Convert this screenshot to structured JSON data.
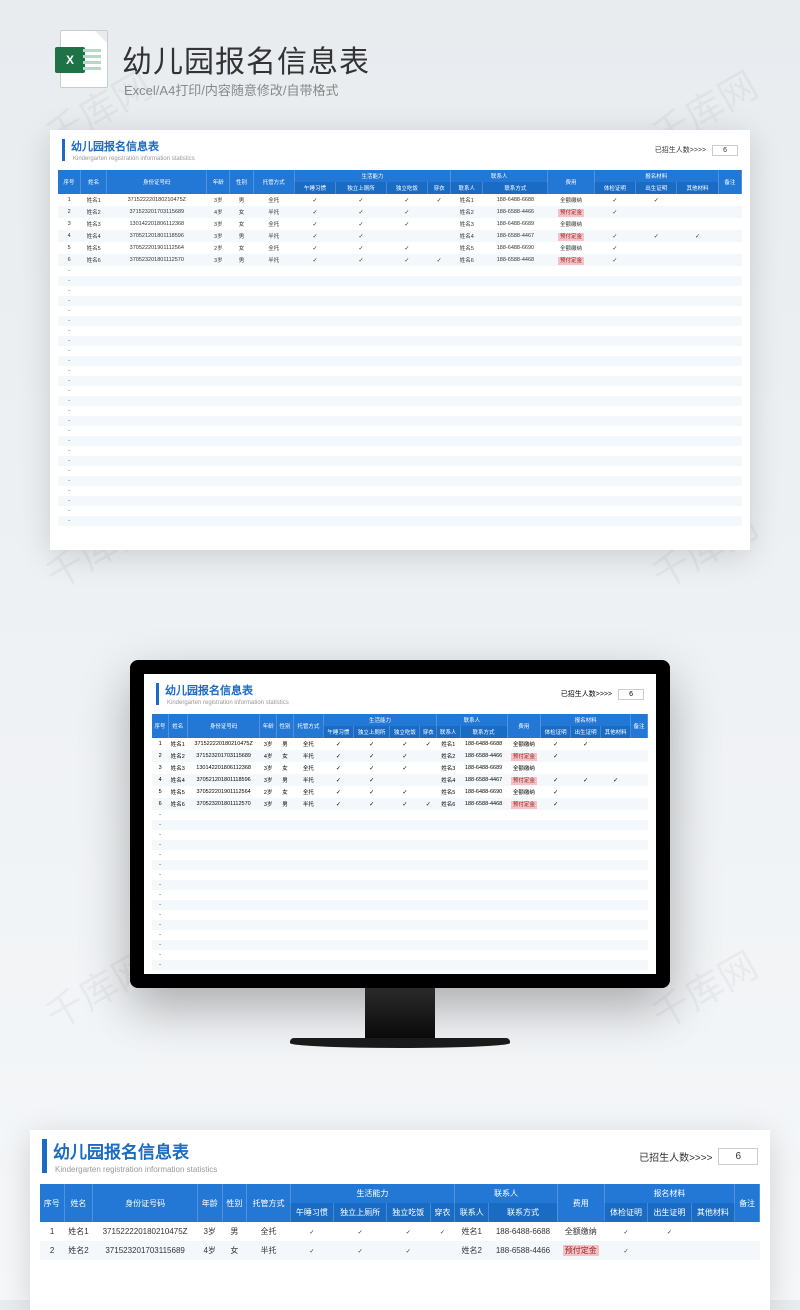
{
  "banner": {
    "title": "幼儿园报名信息表",
    "subtitle": "Excel/A4打印/内容随意修改/自带格式",
    "icon_label": "X"
  },
  "sheet": {
    "title": "幼儿园报名信息表",
    "subtitle": "Kindergarten registration information statistics",
    "enrolled_label": "已招生人数>>>>",
    "enrolled_count": "6"
  },
  "columns": {
    "seq": "序号",
    "name": "姓名",
    "id": "身份证号码",
    "age": "年龄",
    "gender": "性别",
    "care": "托管方式",
    "life_group": "生活能力",
    "nap": "午睡习惯",
    "toilet": "独立上厕所",
    "eat": "独立吃饭",
    "dress": "穿衣",
    "contact_group": "联系人",
    "contact": "联系人",
    "phone": "联系方式",
    "fee": "费用",
    "materials_group": "报名材料",
    "health": "体检证明",
    "birth": "出生证明",
    "other": "其他材料",
    "remark": "备注"
  },
  "fees": {
    "full": "全额缴纳",
    "deposit": "预付定金"
  },
  "rows": [
    {
      "seq": "1",
      "name": "姓名1",
      "id": "371522220180210475Z",
      "age": "3岁",
      "gender": "男",
      "care": "全托",
      "nap": true,
      "toilet": true,
      "eat": true,
      "dress": true,
      "contact": "姓名1",
      "phone": "188-6488-6688",
      "fee": "full",
      "health": true,
      "birth": true,
      "other": false
    },
    {
      "seq": "2",
      "name": "姓名2",
      "id": "371523201703115689",
      "age": "4岁",
      "gender": "女",
      "care": "半托",
      "nap": true,
      "toilet": true,
      "eat": true,
      "dress": false,
      "contact": "姓名2",
      "phone": "188-6588-4466",
      "fee": "deposit",
      "health": true,
      "birth": false,
      "other": false
    },
    {
      "seq": "3",
      "name": "姓名3",
      "id": "130142201806112368",
      "age": "3岁",
      "gender": "女",
      "care": "全托",
      "nap": true,
      "toilet": true,
      "eat": true,
      "dress": false,
      "contact": "姓名3",
      "phone": "188-6488-6689",
      "fee": "full",
      "health": false,
      "birth": false,
      "other": false
    },
    {
      "seq": "4",
      "name": "姓名4",
      "id": "370521201801118596",
      "age": "3岁",
      "gender": "男",
      "care": "半托",
      "nap": true,
      "toilet": true,
      "eat": false,
      "dress": false,
      "contact": "姓名4",
      "phone": "188-6588-4467",
      "fee": "deposit",
      "health": true,
      "birth": true,
      "other": true
    },
    {
      "seq": "5",
      "name": "姓名5",
      "id": "370522201901112564",
      "age": "2岁",
      "gender": "女",
      "care": "全托",
      "nap": true,
      "toilet": true,
      "eat": true,
      "dress": false,
      "contact": "姓名5",
      "phone": "188-6488-6690",
      "fee": "full",
      "health": true,
      "birth": false,
      "other": false
    },
    {
      "seq": "6",
      "name": "姓名6",
      "id": "370523201801112570",
      "age": "3岁",
      "gender": "男",
      "care": "半托",
      "nap": true,
      "toilet": true,
      "eat": true,
      "dress": true,
      "contact": "姓名6",
      "phone": "188-6588-4468",
      "fee": "deposit",
      "health": true,
      "birth": false,
      "other": false
    }
  ],
  "watermark": "千库网"
}
